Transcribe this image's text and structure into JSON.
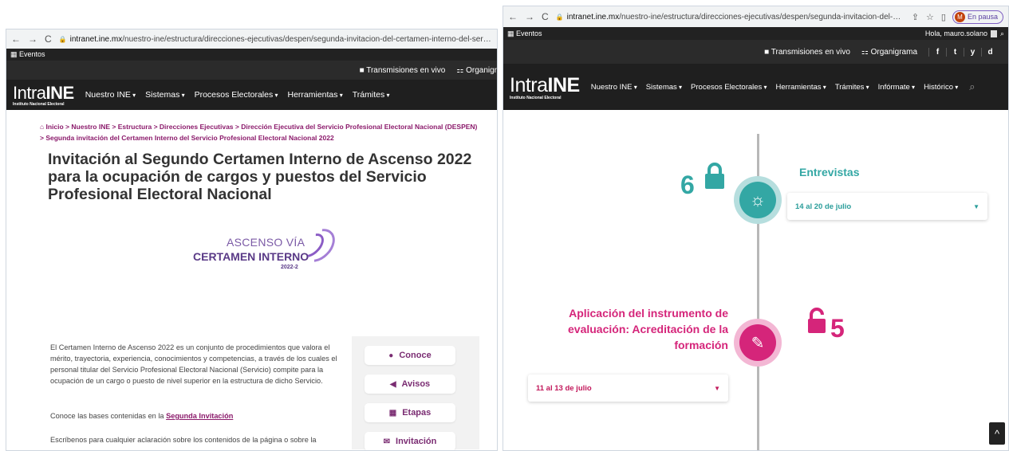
{
  "left": {
    "address": {
      "host": "intranet.ine.mx",
      "path": "/nuestro-ine/estructura/direcciones-ejecutivas/despen/segunda-invitacion-del-certamen-interno-del-servicio-pro"
    },
    "eventos_label": "Eventos",
    "topstrip": {
      "live": "Transmisiones en vivo",
      "org": "Organigr"
    },
    "logo": {
      "name_a": "Intra",
      "name_b": "INE",
      "subtitle": "Instituto Nacional Electoral"
    },
    "menu": [
      "Nuestro INE",
      "Sistemas",
      "Procesos Electorales",
      "Herramientas",
      "Trámites"
    ],
    "breadcrumb": "Inicio > Nuestro INE > Estructura > Direcciones Ejecutivas > Dirección Ejecutiva del Servicio Profesional Electoral Nacional (DESPEN) > Segunda invitación del Certamen Interno del Servicio Profesional Electoral Nacional 2022",
    "title": "Invitación al Segundo Certamen Interno de Ascenso 2022 para la ocupación de cargos y puestos del Servicio Profesional Electoral Nacional",
    "badge": {
      "line1": "ASCENSO VÍA",
      "line2": "CERTAMEN INTERNO",
      "line3": "2022-2"
    },
    "paragraph1": "El Certamen Interno de Ascenso 2022 es un conjunto de procedimientos que valora el mérito, trayectoria, experiencia, conocimientos y competencias, a través de los cuales el personal titular del Servicio Profesional Electoral Nacional (Servicio) compite para la ocupación de un cargo o puesto de nivel superior en la estructura de dicho Servicio.",
    "paragraph2_prefix": "Conoce las bases contenidas en la",
    "paragraph2_link": "Segunda Invitación",
    "paragraph3": "Escríbenos para cualquier aclaración sobre los contenidos de la página o sobre la",
    "buttons": [
      "Conoce",
      "Avisos",
      "Etapas",
      "Invitación"
    ]
  },
  "right": {
    "address": {
      "host": "intranet.ine.mx",
      "path": "/nuestro-ine/estructura/direcciones-ejecutivas/despen/segunda-invitacion-del-certamen-interno-del-servicio-profesion..."
    },
    "profile": {
      "initial": "M",
      "status": "En pausa"
    },
    "eventos_label": "Eventos",
    "greeting": "Hola, mauro.solano",
    "topstrip": {
      "live": "Transmisiones en vivo",
      "org": "Organigrama"
    },
    "social": [
      "f",
      "t",
      "y",
      "d"
    ],
    "logo": {
      "name_a": "Intra",
      "name_b": "INE",
      "subtitle": "Instituto Nacional Electoral"
    },
    "menu": [
      "Nuestro INE",
      "Sistemas",
      "Procesos Electorales",
      "Herramientas",
      "Trámites",
      "Infórmate",
      "Histórico"
    ],
    "phase6": {
      "number": "6",
      "title": "Entrevistas",
      "dates": "14 al 20 de julio"
    },
    "phase5": {
      "number": "5",
      "title": "Aplicación del instrumento de evaluación: Acreditación de la formación",
      "dates": "11 al 13 de julio"
    },
    "colors": {
      "teal": "#33a7a4",
      "pink": "#d5257a",
      "accent": "#8b1a6b"
    }
  }
}
